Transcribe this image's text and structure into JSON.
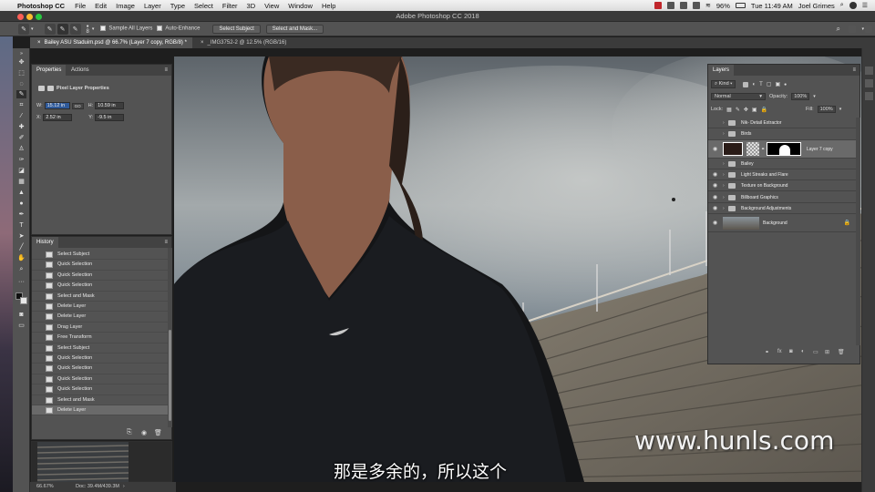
{
  "menubar": {
    "app": "Photoshop CC",
    "items": [
      "File",
      "Edit",
      "Image",
      "Layer",
      "Type",
      "Select",
      "Filter",
      "3D",
      "View",
      "Window",
      "Help"
    ],
    "battery": "96%",
    "clock": "Tue 11:49 AM",
    "user": "Joel Grimes"
  },
  "window": {
    "title": "Adobe Photoshop CC 2018"
  },
  "options": {
    "brush_size": "8",
    "sample_all_layers": "Sample All Layers",
    "auto_enhance": "Auto-Enhance",
    "select_subject": "Select Subject",
    "select_and_mask": "Select and Mask..."
  },
  "tabs": [
    {
      "label": "Bailey ASU Staduim.psd @ 66.7% (Layer 7 copy, RGB/8) *",
      "active": true
    },
    {
      "label": "_IMG3752-2 @ 12.5% (RGB/16)",
      "active": false
    }
  ],
  "properties": {
    "tabs": [
      "Properties",
      "Actions"
    ],
    "title": "Pixel Layer Properties",
    "w_label": "W:",
    "w_value": "15.12 in",
    "link_label": "GO",
    "h_label": "H:",
    "h_value": "10.59 in",
    "x_label": "X:",
    "x_value": "2.52 in",
    "y_label": "Y:",
    "y_value": "-9.5 in"
  },
  "history": {
    "title": "History",
    "items": [
      "Select Subject",
      "Quick Selection",
      "Quick Selection",
      "Quick Selection",
      "Select and Mask",
      "Delete Layer",
      "Delete Layer",
      "Drag Layer",
      "Free Transform",
      "Select Subject",
      "Quick Selection",
      "Quick Selection",
      "Quick Selection",
      "Quick Selection",
      "Select and Mask",
      "Delete Layer"
    ]
  },
  "layers": {
    "title": "Layers",
    "kind": "Kind",
    "blend_mode": "Normal",
    "opacity_label": "Opacity:",
    "opacity": "100%",
    "lock_label": "Lock:",
    "fill_label": "Fill:",
    "fill": "100%",
    "items": [
      {
        "name": "Nik- Detail Extractor",
        "type": "folder",
        "visible": false
      },
      {
        "name": "Birds",
        "type": "folder",
        "visible": false
      },
      {
        "name": "Layer 7 copy",
        "type": "layer",
        "visible": true
      },
      {
        "name": "Bailey",
        "type": "folder",
        "visible": false
      },
      {
        "name": "Light Streaks and Flare",
        "type": "folder",
        "visible": true
      },
      {
        "name": "Texture on Background",
        "type": "folder",
        "visible": true
      },
      {
        "name": "Billboard Graphics",
        "type": "folder",
        "visible": true
      },
      {
        "name": "Background Adjustments",
        "type": "folder",
        "visible": true
      },
      {
        "name": "Background",
        "type": "background",
        "visible": true
      }
    ]
  },
  "status": {
    "zoom": "66.67%",
    "doc": "Doc: 39.4M/439.3M"
  },
  "subtitle": "那是多余的，所以这个",
  "watermark": "www.hunls.com",
  "colors": {
    "ui_dark": "#535353",
    "selected_row": "#6a6a6a",
    "canvas_sky": "#8a9298"
  }
}
